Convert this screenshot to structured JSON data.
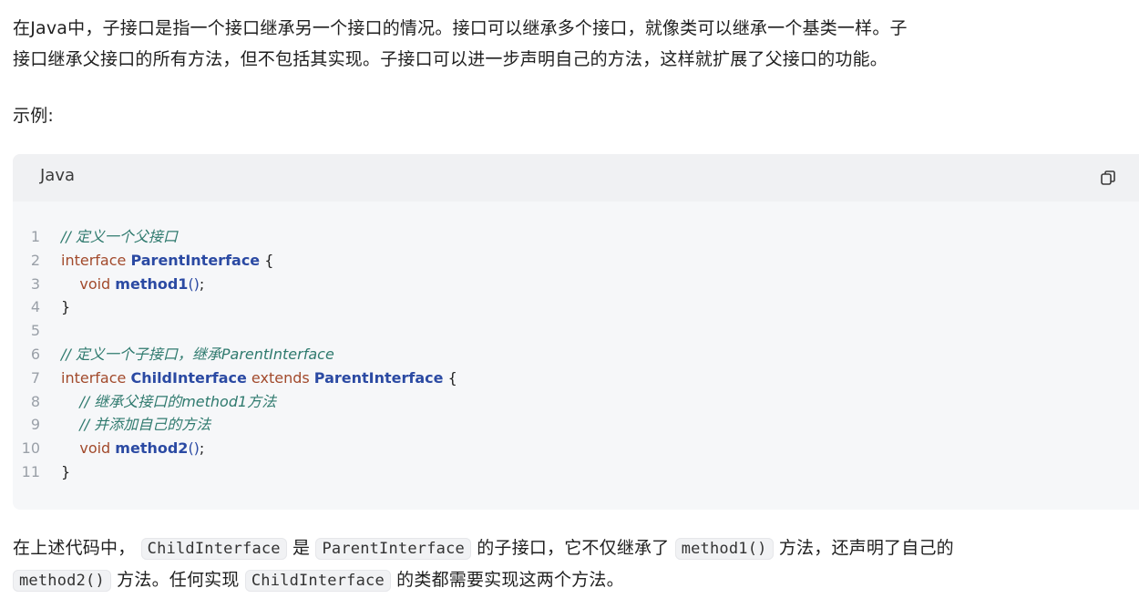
{
  "intro": {
    "line1": "在Java中，子接口是指一个接口继承另一个接口的情况。接口可以继承多个接口，就像类可以继承一个基类一样。子",
    "line2": "接口继承父接口的所有方法，但不包括其实现。子接口可以进一步声明自己的方法，这样就扩展了父接口的功能。"
  },
  "example_label": "示例:",
  "code_block": {
    "language": "Java",
    "copy_icon": "copy-icon",
    "lines": [
      {
        "n": "1",
        "parts": [
          {
            "t": "// 定义一个父接口",
            "c": "cm"
          }
        ]
      },
      {
        "n": "2",
        "parts": [
          {
            "t": "interface ",
            "c": "kw"
          },
          {
            "t": "ParentInterface",
            "c": "ty"
          },
          {
            "t": " {",
            "c": "tx"
          }
        ]
      },
      {
        "n": "3",
        "parts": [
          {
            "t": "    void ",
            "c": "kw"
          },
          {
            "t": "method1",
            "c": "fn"
          },
          {
            "t": "()",
            "c": "pn"
          },
          {
            "t": ";",
            "c": "tx"
          }
        ]
      },
      {
        "n": "4",
        "parts": [
          {
            "t": "}",
            "c": "tx"
          }
        ]
      },
      {
        "n": "5",
        "parts": []
      },
      {
        "n": "6",
        "parts": [
          {
            "t": "// 定义一个子接口，继承ParentInterface",
            "c": "cm"
          }
        ]
      },
      {
        "n": "7",
        "parts": [
          {
            "t": "interface ",
            "c": "kw"
          },
          {
            "t": "ChildInterface",
            "c": "ty"
          },
          {
            "t": " extends ",
            "c": "kw"
          },
          {
            "t": "ParentInterface",
            "c": "ty"
          },
          {
            "t": " {",
            "c": "tx"
          }
        ]
      },
      {
        "n": "8",
        "parts": [
          {
            "t": "    // 继承父接口的method1方法",
            "c": "cm"
          }
        ]
      },
      {
        "n": "9",
        "parts": [
          {
            "t": "    // 并添加自己的方法",
            "c": "cm"
          }
        ]
      },
      {
        "n": "10",
        "parts": [
          {
            "t": "    void ",
            "c": "kw"
          },
          {
            "t": "method2",
            "c": "fn"
          },
          {
            "t": "()",
            "c": "pn"
          },
          {
            "t": ";",
            "c": "tx"
          }
        ]
      },
      {
        "n": "11",
        "parts": [
          {
            "t": "}",
            "c": "tx"
          }
        ]
      }
    ]
  },
  "summary": {
    "t1": "在上述代码中，",
    "c1": "ChildInterface",
    "t2": "是",
    "c2": "ParentInterface",
    "t3": "的子接口，它不仅继承了",
    "c3": "method1()",
    "t4": "方法，还声明了自己的",
    "c4": "method2()",
    "t5": "方法。任何实现",
    "c5": "ChildInterface",
    "t6": "的类都需要实现这两个方法。"
  }
}
